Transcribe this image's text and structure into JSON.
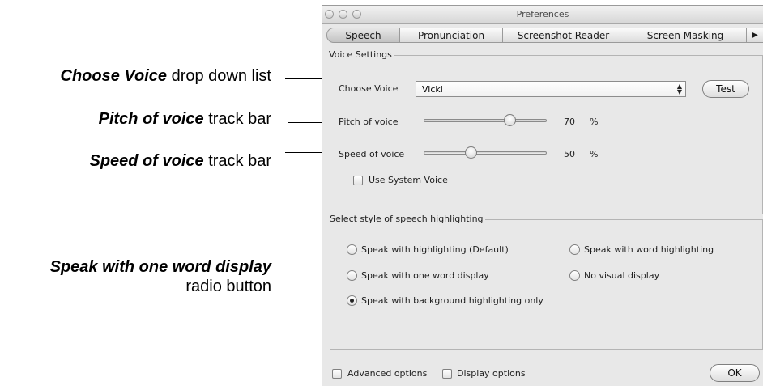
{
  "annotations": {
    "choose_voice": {
      "bold": "Choose Voice",
      "rest": " drop down list"
    },
    "pitch": {
      "bold": "Pitch of voice",
      "rest": " track bar"
    },
    "speed": {
      "bold": "Speed of voice",
      "rest": " track bar"
    },
    "one_word": {
      "bold": "Speak with one word display",
      "line2": "radio button"
    }
  },
  "window": {
    "title": "Preferences"
  },
  "tabs": [
    "Speech",
    "Pronunciation",
    "Screenshot Reader",
    "Screen Masking",
    "▶"
  ],
  "voice_settings": {
    "group_label": "Voice Settings",
    "choose_voice_label": "Choose Voice",
    "choose_voice_value": "Vicki",
    "test_button": "Test",
    "pitch_label": "Pitch of voice",
    "pitch_value": "70",
    "pitch_unit": "%",
    "speed_label": "Speed of voice",
    "speed_value": "50",
    "speed_unit": "%",
    "use_system_voice": "Use System Voice",
    "use_system_voice_checked": false
  },
  "highlighting": {
    "group_label": "Select style of speech highlighting",
    "options": [
      "Speak with highlighting (Default)",
      "Speak with word highlighting",
      "Speak with one word display",
      "No visual display",
      "Speak with background highlighting only"
    ],
    "selected": "Speak with background highlighting only"
  },
  "bottom": {
    "advanced_options": "Advanced options",
    "display_options": "Display options",
    "ok_button": "OK"
  },
  "icons": {
    "stepper": "up-down-arrows-icon",
    "tab_overflow": "triangle-right-icon"
  }
}
